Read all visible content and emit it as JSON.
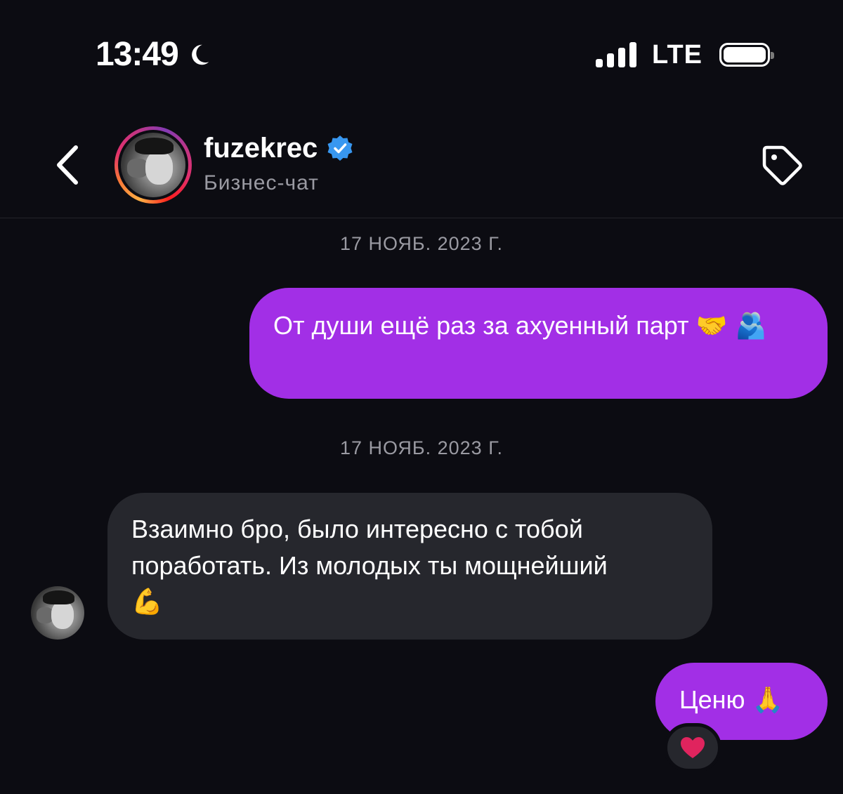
{
  "status_bar": {
    "time": "13:49",
    "network": "LTE"
  },
  "header": {
    "username": "fuzekrec",
    "subtitle": "Бизнес-чат",
    "icons": [
      "chevron-left-icon",
      "verified-badge-icon",
      "tag-icon"
    ],
    "colors": {
      "verified": "#3897f0"
    }
  },
  "messages": [
    {
      "type": "date",
      "text": "17 НОЯБ. 2023 Г."
    },
    {
      "type": "outgoing",
      "text": "От души ещё раз за ахуенный парт",
      "emoji": "🤝 🫂"
    },
    {
      "type": "date",
      "text": "17 НОЯБ. 2023 Г."
    },
    {
      "type": "incoming",
      "line1": "Взаимно бро, было интересно с тобой",
      "line2": "поработать. Из молодых ты мощнейший",
      "emoji": "💪"
    },
    {
      "type": "outgoing",
      "text": "Ценю",
      "emoji": "🙏",
      "reaction": "heart"
    }
  ],
  "colors": {
    "background": "#0c0c12",
    "outgoing_bubble": "#a22fe6",
    "incoming_bubble": "#26272d",
    "reaction_heart": "#e0245e"
  }
}
